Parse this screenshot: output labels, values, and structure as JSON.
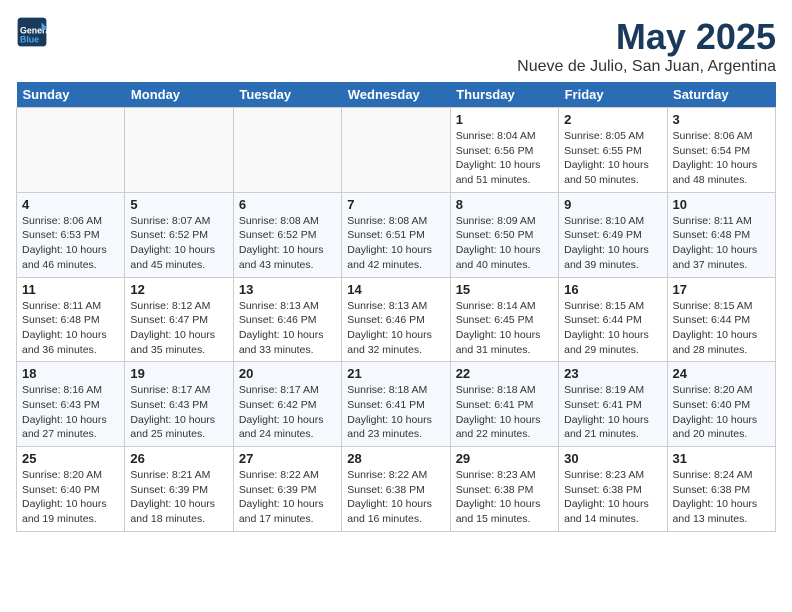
{
  "header": {
    "logo_line1": "General",
    "logo_line2": "Blue",
    "title": "May 2025",
    "subtitle": "Nueve de Julio, San Juan, Argentina"
  },
  "weekdays": [
    "Sunday",
    "Monday",
    "Tuesday",
    "Wednesday",
    "Thursday",
    "Friday",
    "Saturday"
  ],
  "weeks": [
    [
      {
        "day": "",
        "info": ""
      },
      {
        "day": "",
        "info": ""
      },
      {
        "day": "",
        "info": ""
      },
      {
        "day": "",
        "info": ""
      },
      {
        "day": "1",
        "info": "Sunrise: 8:04 AM\nSunset: 6:56 PM\nDaylight: 10 hours\nand 51 minutes."
      },
      {
        "day": "2",
        "info": "Sunrise: 8:05 AM\nSunset: 6:55 PM\nDaylight: 10 hours\nand 50 minutes."
      },
      {
        "day": "3",
        "info": "Sunrise: 8:06 AM\nSunset: 6:54 PM\nDaylight: 10 hours\nand 48 minutes."
      }
    ],
    [
      {
        "day": "4",
        "info": "Sunrise: 8:06 AM\nSunset: 6:53 PM\nDaylight: 10 hours\nand 46 minutes."
      },
      {
        "day": "5",
        "info": "Sunrise: 8:07 AM\nSunset: 6:52 PM\nDaylight: 10 hours\nand 45 minutes."
      },
      {
        "day": "6",
        "info": "Sunrise: 8:08 AM\nSunset: 6:52 PM\nDaylight: 10 hours\nand 43 minutes."
      },
      {
        "day": "7",
        "info": "Sunrise: 8:08 AM\nSunset: 6:51 PM\nDaylight: 10 hours\nand 42 minutes."
      },
      {
        "day": "8",
        "info": "Sunrise: 8:09 AM\nSunset: 6:50 PM\nDaylight: 10 hours\nand 40 minutes."
      },
      {
        "day": "9",
        "info": "Sunrise: 8:10 AM\nSunset: 6:49 PM\nDaylight: 10 hours\nand 39 minutes."
      },
      {
        "day": "10",
        "info": "Sunrise: 8:11 AM\nSunset: 6:48 PM\nDaylight: 10 hours\nand 37 minutes."
      }
    ],
    [
      {
        "day": "11",
        "info": "Sunrise: 8:11 AM\nSunset: 6:48 PM\nDaylight: 10 hours\nand 36 minutes."
      },
      {
        "day": "12",
        "info": "Sunrise: 8:12 AM\nSunset: 6:47 PM\nDaylight: 10 hours\nand 35 minutes."
      },
      {
        "day": "13",
        "info": "Sunrise: 8:13 AM\nSunset: 6:46 PM\nDaylight: 10 hours\nand 33 minutes."
      },
      {
        "day": "14",
        "info": "Sunrise: 8:13 AM\nSunset: 6:46 PM\nDaylight: 10 hours\nand 32 minutes."
      },
      {
        "day": "15",
        "info": "Sunrise: 8:14 AM\nSunset: 6:45 PM\nDaylight: 10 hours\nand 31 minutes."
      },
      {
        "day": "16",
        "info": "Sunrise: 8:15 AM\nSunset: 6:44 PM\nDaylight: 10 hours\nand 29 minutes."
      },
      {
        "day": "17",
        "info": "Sunrise: 8:15 AM\nSunset: 6:44 PM\nDaylight: 10 hours\nand 28 minutes."
      }
    ],
    [
      {
        "day": "18",
        "info": "Sunrise: 8:16 AM\nSunset: 6:43 PM\nDaylight: 10 hours\nand 27 minutes."
      },
      {
        "day": "19",
        "info": "Sunrise: 8:17 AM\nSunset: 6:43 PM\nDaylight: 10 hours\nand 25 minutes."
      },
      {
        "day": "20",
        "info": "Sunrise: 8:17 AM\nSunset: 6:42 PM\nDaylight: 10 hours\nand 24 minutes."
      },
      {
        "day": "21",
        "info": "Sunrise: 8:18 AM\nSunset: 6:41 PM\nDaylight: 10 hours\nand 23 minutes."
      },
      {
        "day": "22",
        "info": "Sunrise: 8:18 AM\nSunset: 6:41 PM\nDaylight: 10 hours\nand 22 minutes."
      },
      {
        "day": "23",
        "info": "Sunrise: 8:19 AM\nSunset: 6:41 PM\nDaylight: 10 hours\nand 21 minutes."
      },
      {
        "day": "24",
        "info": "Sunrise: 8:20 AM\nSunset: 6:40 PM\nDaylight: 10 hours\nand 20 minutes."
      }
    ],
    [
      {
        "day": "25",
        "info": "Sunrise: 8:20 AM\nSunset: 6:40 PM\nDaylight: 10 hours\nand 19 minutes."
      },
      {
        "day": "26",
        "info": "Sunrise: 8:21 AM\nSunset: 6:39 PM\nDaylight: 10 hours\nand 18 minutes."
      },
      {
        "day": "27",
        "info": "Sunrise: 8:22 AM\nSunset: 6:39 PM\nDaylight: 10 hours\nand 17 minutes."
      },
      {
        "day": "28",
        "info": "Sunrise: 8:22 AM\nSunset: 6:38 PM\nDaylight: 10 hours\nand 16 minutes."
      },
      {
        "day": "29",
        "info": "Sunrise: 8:23 AM\nSunset: 6:38 PM\nDaylight: 10 hours\nand 15 minutes."
      },
      {
        "day": "30",
        "info": "Sunrise: 8:23 AM\nSunset: 6:38 PM\nDaylight: 10 hours\nand 14 minutes."
      },
      {
        "day": "31",
        "info": "Sunrise: 8:24 AM\nSunset: 6:38 PM\nDaylight: 10 hours\nand 13 minutes."
      }
    ]
  ]
}
